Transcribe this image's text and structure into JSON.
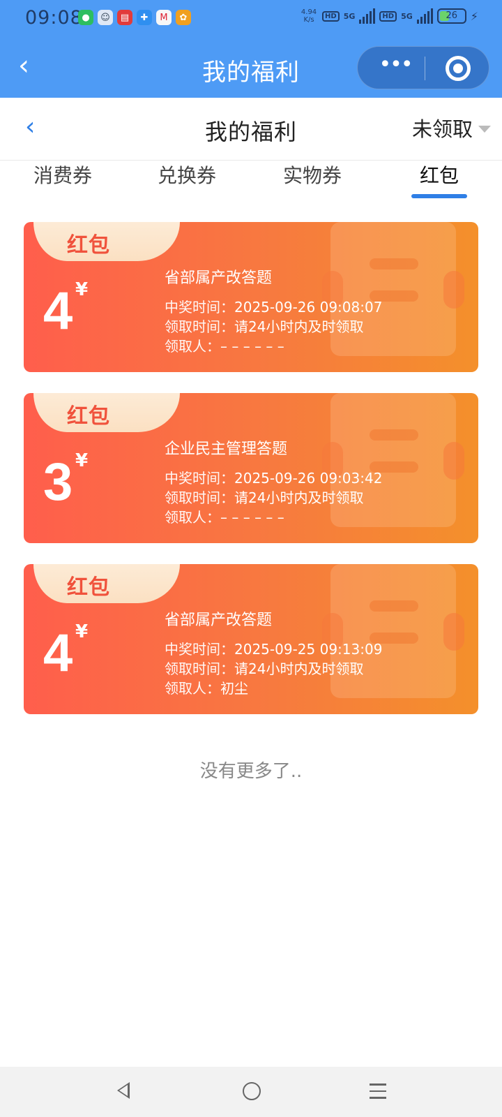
{
  "status": {
    "time": "09:08",
    "net_speed_value": "4.94",
    "net_speed_unit": "K/s",
    "hd1": "HD",
    "sig1": "5G",
    "hd2": "HD",
    "sig2": "5G",
    "battery": "26",
    "app_icons": [
      "wechat-icon",
      "contacts-icon",
      "store-icon",
      "puzzle-icon",
      "bank-icon",
      "flower-icon"
    ]
  },
  "miniapp_nav": {
    "title": "我的福利",
    "more_label": "•••"
  },
  "page_header": {
    "title": "我的福利",
    "filter_label": "未领取"
  },
  "tabs": [
    {
      "label": "消费券",
      "active": false
    },
    {
      "label": "兑换券",
      "active": false
    },
    {
      "label": "实物券",
      "active": false
    },
    {
      "label": "红包",
      "active": true
    }
  ],
  "cards": [
    {
      "tag": "红包",
      "amount": "4",
      "currency": "¥",
      "name": "省部属产改答题",
      "win_time_label": "中奖时间：",
      "win_time": "2025-09-26 09:08:07",
      "claim_time_label": "领取时间：",
      "claim_time": "请24小时内及时领取",
      "claimer_label": "领取人：",
      "claimer": "– – – – – –"
    },
    {
      "tag": "红包",
      "amount": "3",
      "currency": "¥",
      "name": "企业民主管理答题",
      "win_time_label": "中奖时间：",
      "win_time": "2025-09-26 09:03:42",
      "claim_time_label": "领取时间：",
      "claim_time": "请24小时内及时领取",
      "claimer_label": "领取人：",
      "claimer": "– – – – – –"
    },
    {
      "tag": "红包",
      "amount": "4",
      "currency": "¥",
      "name": "省部属产改答题",
      "win_time_label": "中奖时间：",
      "win_time": "2025-09-25 09:13:09",
      "claim_time_label": "领取时间：",
      "claim_time": "请24小时内及时领取",
      "claimer_label": "领取人：",
      "claimer": "初尘"
    }
  ],
  "footer": {
    "no_more": "没有更多了.."
  },
  "colors": {
    "brand_blue": "#4e9bf5",
    "accent_blue": "#2f7fe6",
    "card_red": "#ff5e4c",
    "card_orange": "#f4902b",
    "tag_bg": "#fbe0c2"
  }
}
